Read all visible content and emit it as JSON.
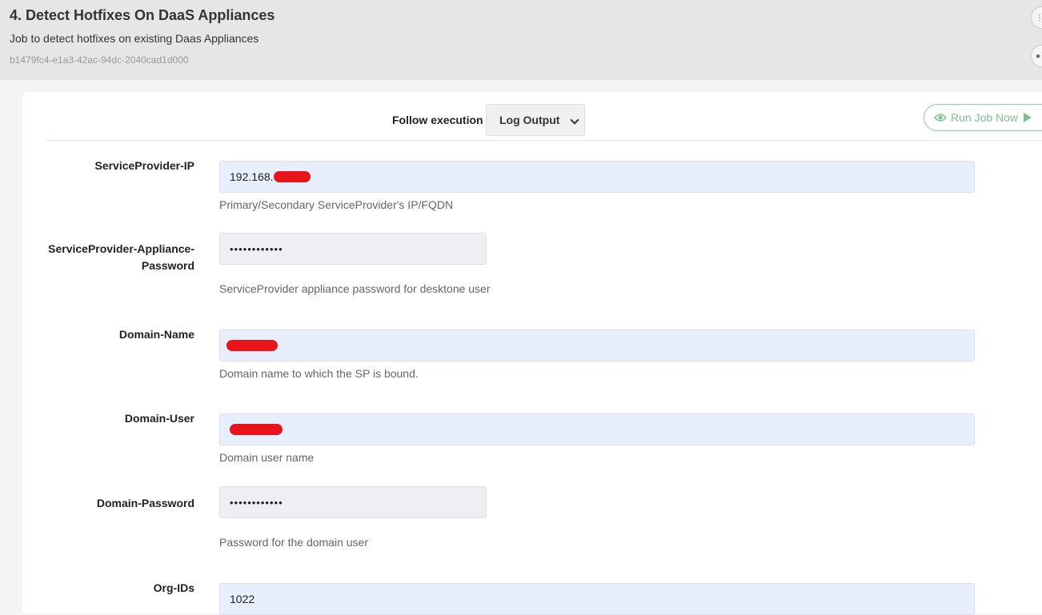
{
  "header": {
    "title": "4. Detect Hotfixes On DaaS Appliances",
    "description": "Job to detect hotfixes on existing Daas Appliances",
    "uuid": "b1479fc4-e1a3-42ac-94dc-2040cad1d000"
  },
  "toolbar": {
    "follow_label": "Follow execution",
    "follow_select_value": "Log Output",
    "run_button_label": "Run Job Now"
  },
  "colors": {
    "accent_green": "#7cc28c",
    "redaction": "#e8141a",
    "input_bg": "#e8effc"
  },
  "fields": {
    "sp_ip": {
      "label": "ServiceProvider-IP",
      "value": "192.168.",
      "help": "Primary/Secondary ServiceProvider's IP/FQDN"
    },
    "sp_password": {
      "label_line1": "ServiceProvider-Appliance-",
      "label_line2": "Password",
      "value": "••••••••••••",
      "help": "ServiceProvider appliance password for desktone user"
    },
    "domain_name": {
      "label": "Domain-Name",
      "value": "",
      "help": "Domain name to which the SP is bound."
    },
    "domain_user": {
      "label": "Domain-User",
      "value": "",
      "help": "Domain user name"
    },
    "domain_password": {
      "label": "Domain-Password",
      "value": "••••••••••••",
      "help": "Password for the domain user"
    },
    "org_ids": {
      "label": "Org-IDs",
      "value": "1022"
    }
  }
}
